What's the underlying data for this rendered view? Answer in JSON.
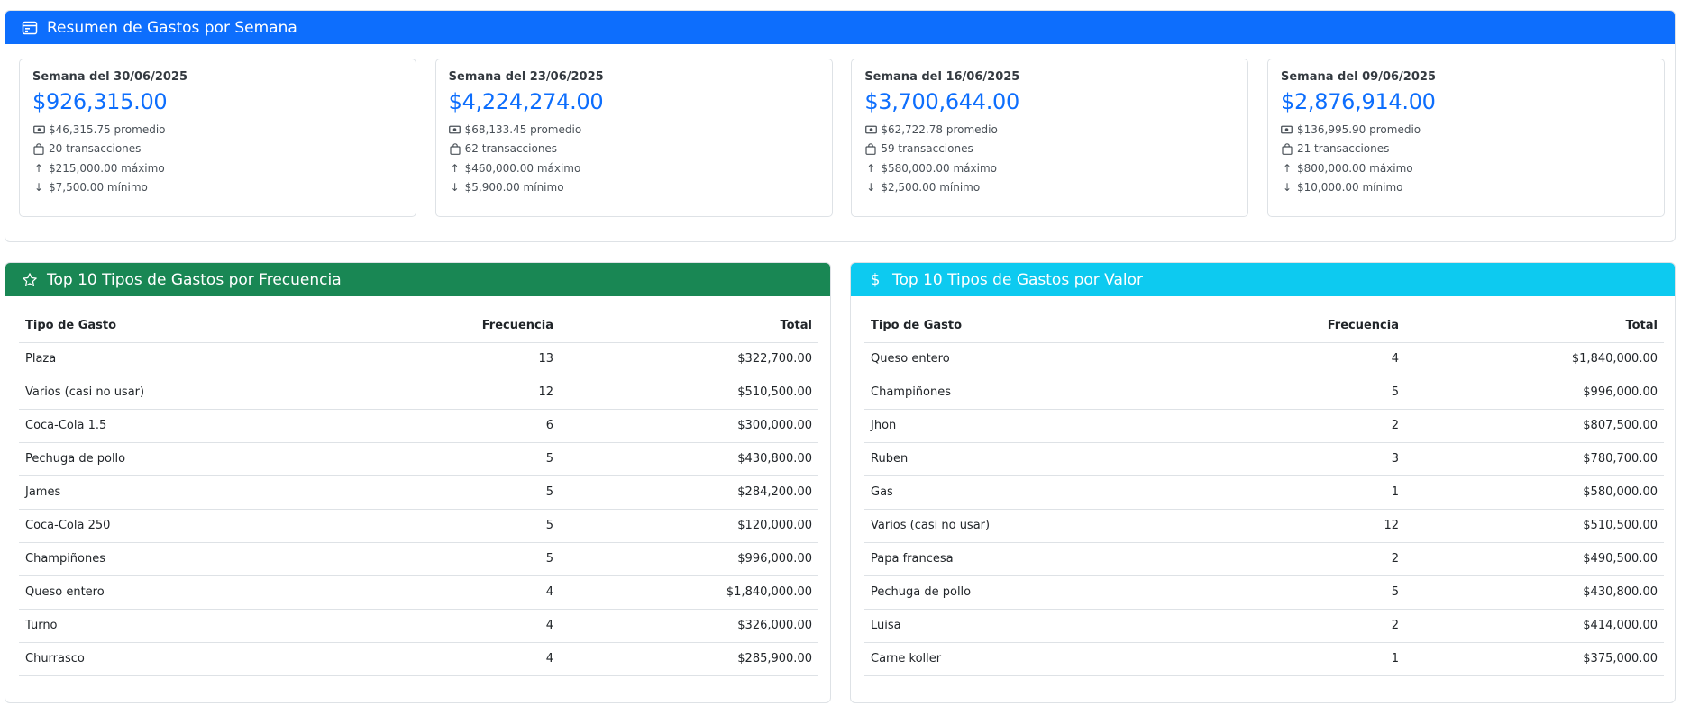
{
  "summary": {
    "title": "Resumen de Gastos por Semana",
    "icon": "calendar-icon",
    "weeks": [
      {
        "label": "Semana del 30/06/2025",
        "total": "$926,315.00",
        "avg": "$46,315.75 promedio",
        "count": "20 transacciones",
        "max": "$215,000.00 máximo",
        "min": "$7,500.00 mínimo"
      },
      {
        "label": "Semana del 23/06/2025",
        "total": "$4,224,274.00",
        "avg": "$68,133.45 promedio",
        "count": "62 transacciones",
        "max": "$460,000.00 máximo",
        "min": "$5,900.00 mínimo"
      },
      {
        "label": "Semana del 16/06/2025",
        "total": "$3,700,644.00",
        "avg": "$62,722.78 promedio",
        "count": "59 transacciones",
        "max": "$580,000.00 máximo",
        "min": "$2,500.00 mínimo"
      },
      {
        "label": "Semana del 09/06/2025",
        "total": "$2,876,914.00",
        "avg": "$136,995.90 promedio",
        "count": "21 transacciones",
        "max": "$800,000.00 máximo",
        "min": "$10,000.00 mínimo"
      }
    ]
  },
  "freq": {
    "title": "Top 10 Tipos de Gastos por Frecuencia",
    "icon": "star-icon",
    "columns": [
      "Tipo de Gasto",
      "Frecuencia",
      "Total"
    ],
    "rows": [
      {
        "tipo": "Plaza",
        "freq": "13",
        "total": "$322,700.00"
      },
      {
        "tipo": "Varios (casi no usar)",
        "freq": "12",
        "total": "$510,500.00"
      },
      {
        "tipo": "Coca-Cola 1.5",
        "freq": "6",
        "total": "$300,000.00"
      },
      {
        "tipo": "Pechuga de pollo",
        "freq": "5",
        "total": "$430,800.00"
      },
      {
        "tipo": "James",
        "freq": "5",
        "total": "$284,200.00"
      },
      {
        "tipo": "Coca-Cola 250",
        "freq": "5",
        "total": "$120,000.00"
      },
      {
        "tipo": "Champiñones",
        "freq": "5",
        "total": "$996,000.00"
      },
      {
        "tipo": "Queso entero",
        "freq": "4",
        "total": "$1,840,000.00"
      },
      {
        "tipo": "Turno",
        "freq": "4",
        "total": "$326,000.00"
      },
      {
        "tipo": "Churrasco",
        "freq": "4",
        "total": "$285,900.00"
      }
    ]
  },
  "value": {
    "title": "Top 10 Tipos de Gastos por Valor",
    "icon": "dollar-icon",
    "columns": [
      "Tipo de Gasto",
      "Frecuencia",
      "Total"
    ],
    "rows": [
      {
        "tipo": "Queso entero",
        "freq": "4",
        "total": "$1,840,000.00"
      },
      {
        "tipo": "Champiñones",
        "freq": "5",
        "total": "$996,000.00"
      },
      {
        "tipo": "Jhon",
        "freq": "2",
        "total": "$807,500.00"
      },
      {
        "tipo": "Ruben",
        "freq": "3",
        "total": "$780,700.00"
      },
      {
        "tipo": "Gas",
        "freq": "1",
        "total": "$580,000.00"
      },
      {
        "tipo": "Varios (casi no usar)",
        "freq": "12",
        "total": "$510,500.00"
      },
      {
        "tipo": "Papa francesa",
        "freq": "2",
        "total": "$490,500.00"
      },
      {
        "tipo": "Pechuga de pollo",
        "freq": "5",
        "total": "$430,800.00"
      },
      {
        "tipo": "Luisa",
        "freq": "2",
        "total": "$414,000.00"
      },
      {
        "tipo": "Carne koller",
        "freq": "1",
        "total": "$375,000.00"
      }
    ]
  }
}
